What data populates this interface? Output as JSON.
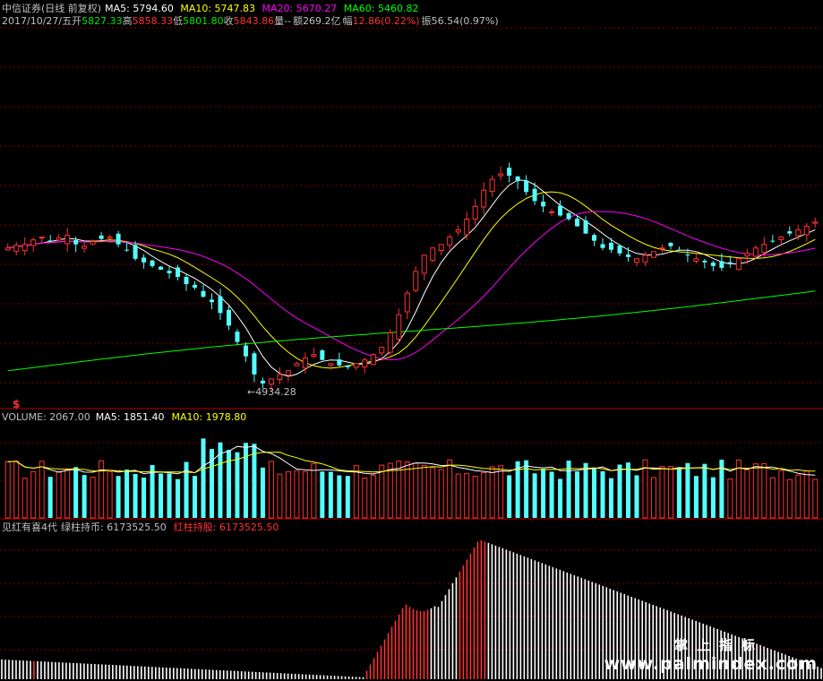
{
  "colors": {
    "up": "#ff3232",
    "down": "#54ffff",
    "grid": "#7f0000",
    "ma5": "#ffffff",
    "ma10": "#ffff00",
    "ma20": "#ff00ff",
    "ma60": "#00ff00",
    "label": "#c0c0c0",
    "green_text": "#00e600",
    "red_text": "#ff3232"
  },
  "header": {
    "title": "中信证券(日线 前复权)",
    "ma5_label": "MA5:",
    "ma5_value": "5794.60",
    "ma10_label": "MA10:",
    "ma10_value": "5747.83",
    "ma20_label": "MA20:",
    "ma20_value": "5670.27",
    "ma60_label": "MA60:",
    "ma60_value": "5460.82"
  },
  "quote": {
    "date": "2017/10/27/五",
    "open_label": "开",
    "open": "5827.33",
    "high_label": "高",
    "high": "5858.33",
    "low_label": "低",
    "low": "5801.80",
    "close_label": "收",
    "close": "5843.86",
    "volume_label": "量",
    "volume": "--",
    "amount_label": "额",
    "amount": "269.2亿",
    "change_label": "幅",
    "change": "12.86(0.22%)",
    "amplitude_label": "振",
    "amplitude": "56.54(0.97%)"
  },
  "low_marker": "←4934.28",
  "dollar_icon": "$",
  "volume_panel": {
    "label": "VOLUME:",
    "value": "2067.00",
    "ma5_label": "MA5:",
    "ma5_value": "1851.40",
    "ma10_label": "MA10:",
    "ma10_value": "1978.80"
  },
  "indicator_panel": {
    "name": "见红有喜4代",
    "green_label": "绿柱持币:",
    "green_value": "6173525.50",
    "red_label": "红柱持股:",
    "red_value": "6173525.50"
  },
  "watermark": {
    "line1": "掌上指标",
    "line2": "www.palmindex.com"
  },
  "chart_data": [
    {
      "type": "candlestick",
      "title": "中信证券(日线 前复权)",
      "series": [
        {
          "name": "MA5",
          "last": 5794.6
        },
        {
          "name": "MA10",
          "last": 5747.83
        },
        {
          "name": "MA20",
          "last": 5670.27
        },
        {
          "name": "MA60",
          "last": 5460.82
        }
      ],
      "last_bar": {
        "date": "2017/10/27",
        "open": 5827.33,
        "high": 5858.33,
        "low": 5801.8,
        "close": 5843.86
      },
      "min_marker": 4934.28,
      "close_path": [
        5700,
        5715,
        5720,
        5745,
        5760,
        5740,
        5755,
        5770,
        5720,
        5710,
        5735,
        5750,
        5760,
        5720,
        5690,
        5640,
        5620,
        5600,
        5580,
        5560,
        5540,
        5500,
        5480,
        5430,
        5400,
        5340,
        5270,
        5180,
        5100,
        5000,
        4950,
        4975,
        5000,
        5020,
        5060,
        5090,
        5110,
        5080,
        5060,
        5050,
        5040,
        5060,
        5080,
        5110,
        5150,
        5230,
        5330,
        5450,
        5570,
        5660,
        5700,
        5720,
        5760,
        5800,
        5860,
        5930,
        6020,
        6080,
        6110,
        6100,
        6070,
        6010,
        5960,
        5930,
        5900,
        5880,
        5860,
        5820,
        5780,
        5740,
        5700,
        5690,
        5670,
        5650,
        5640,
        5660,
        5680,
        5700,
        5710,
        5690,
        5660,
        5640,
        5620,
        5600,
        5590,
        5610,
        5640,
        5670,
        5700,
        5720,
        5740,
        5760,
        5780,
        5800,
        5820,
        5843.86
      ]
    },
    {
      "type": "bar",
      "title": "VOLUME",
      "series": [
        {
          "name": "VOLUME",
          "last": 2067.0
        },
        {
          "name": "MA5",
          "last": 1851.4
        },
        {
          "name": "MA10",
          "last": 1978.8
        }
      ]
    },
    {
      "type": "bar",
      "title": "见红有喜4代",
      "series": [
        {
          "name": "绿柱持币",
          "last": 6173525.5
        },
        {
          "name": "红柱持股",
          "last": 6173525.5
        }
      ]
    }
  ]
}
